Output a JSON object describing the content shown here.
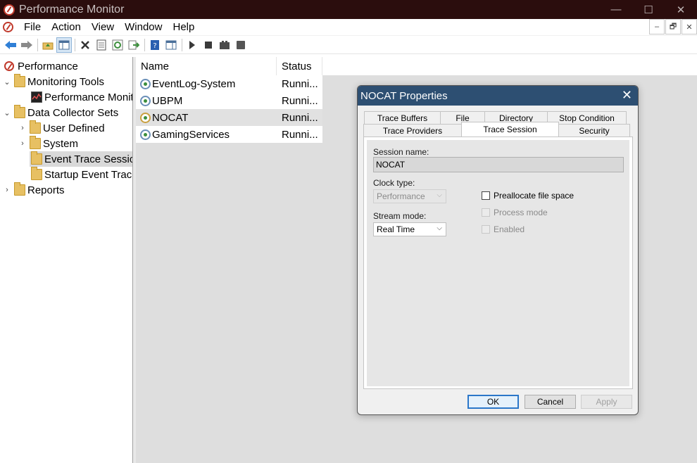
{
  "window": {
    "title": "Performance Monitor",
    "controls": {
      "minimize": "—",
      "maximize": "☐",
      "close": "✕"
    }
  },
  "menu": [
    "File",
    "Action",
    "View",
    "Window",
    "Help"
  ],
  "mdi": {
    "minimize": "–",
    "restore": "🗗",
    "close": "✕"
  },
  "toolbar": [
    "back-icon",
    "forward-icon",
    "up-folder-icon",
    "show-hide-tree-icon",
    "delete-icon",
    "properties-icon",
    "refresh-icon",
    "export-icon",
    "help-icon",
    "show-hide-action-icon",
    "start-icon",
    "stop-icon",
    "new-icon",
    "record-icon"
  ],
  "tree": {
    "items": [
      {
        "label": "Performance",
        "level": 0,
        "expand": ""
      },
      {
        "label": "Monitoring Tools",
        "level": 1,
        "expand": "⌄"
      },
      {
        "label": "Performance Monitor",
        "level": 2,
        "expand": ""
      },
      {
        "label": "Data Collector Sets",
        "level": 1,
        "expand": "⌄"
      },
      {
        "label": "User Defined",
        "level": 2,
        "expand": "›"
      },
      {
        "label": "System",
        "level": 2,
        "expand": "›"
      },
      {
        "label": "Event Trace Sessions",
        "level": 2,
        "expand": ""
      },
      {
        "label": "Startup Event Trace Sessions",
        "level": 2,
        "expand": ""
      },
      {
        "label": "Reports",
        "level": 1,
        "expand": "›"
      }
    ]
  },
  "list": {
    "columns": [
      "Name",
      "Status"
    ],
    "rows": [
      {
        "name": "EventLog-System",
        "status": "Runni..."
      },
      {
        "name": "UBPM",
        "status": "Runni..."
      },
      {
        "name": "NOCAT",
        "status": "Runni..."
      },
      {
        "name": "GamingServices",
        "status": "Runni..."
      }
    ]
  },
  "dialog": {
    "title": "NOCAT Properties",
    "close": "✕",
    "tabs_back": [
      "Trace Buffers",
      "File",
      "Directory",
      "Stop Condition"
    ],
    "tabs_front": [
      "Trace Providers",
      "Trace Session",
      "Security"
    ],
    "active_tab": "Trace Session",
    "session_name_label": "Session name:",
    "session_name_value": "NOCAT",
    "clock_type_label": "Clock type:",
    "clock_type_value": "Performance",
    "stream_mode_label": "Stream mode:",
    "stream_mode_value": "Real Time",
    "preallocate_label": "Preallocate file space",
    "process_mode_label": "Process mode",
    "enabled_label": "Enabled",
    "ok": "OK",
    "cancel": "Cancel",
    "apply": "Apply"
  },
  "colors": {
    "titlebar": "#2b0d0d",
    "dialog_title": "#2d4f72",
    "default_button": "#2b77c9"
  }
}
